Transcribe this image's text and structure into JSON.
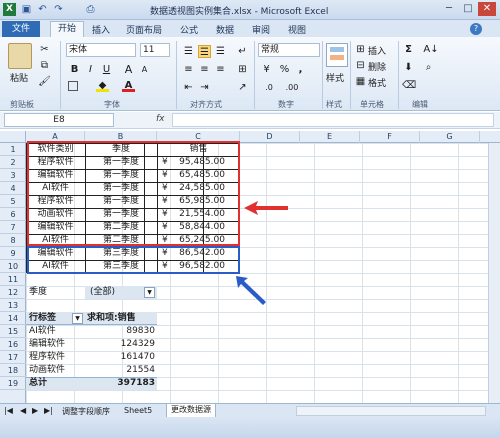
{
  "window": {
    "title": "数据透视图实例集合.xlsx - Microsoft Excel",
    "quick_access": [
      "save-icon",
      "undo-icon",
      "redo-icon",
      "print-icon"
    ],
    "controls": [
      "minimize-icon",
      "maximize-icon",
      "close-icon"
    ]
  },
  "ribbon_tabs": {
    "file": "文件",
    "items": [
      "开始",
      "插入",
      "页面布局",
      "公式",
      "数据",
      "审阅",
      "视图"
    ]
  },
  "ribbon": {
    "clipboard": {
      "label": "剪贴板",
      "paste": "粘贴"
    },
    "font": {
      "label": "字体",
      "name": "宋体",
      "size": "11",
      "bold": "B",
      "italic": "I",
      "underline": "U",
      "grow": "A",
      "shrink": "A"
    },
    "alignment": {
      "label": "对齐方式"
    },
    "number": {
      "label": "数字",
      "format": "常规",
      "percent": "%",
      "comma": ",",
      "increase_decimal": ".0",
      "decrease_decimal": ".00"
    },
    "styles": {
      "label": "样式",
      "button": "样式"
    },
    "cells": {
      "label": "单元格",
      "insert": "插入",
      "delete": "删除",
      "format": "格式"
    },
    "editing": {
      "label": "编辑",
      "sum": "Σ",
      "sort": "A↓"
    }
  },
  "formula_bar": {
    "name_box": "E8",
    "fx": "fx",
    "value": ""
  },
  "grid": {
    "columns": [
      "A",
      "B",
      "C",
      "D",
      "E",
      "F",
      "G"
    ],
    "rows": [
      "1",
      "2",
      "3",
      "4",
      "5",
      "6",
      "7",
      "8",
      "9",
      "10",
      "11",
      "12",
      "13",
      "14",
      "15",
      "16",
      "17",
      "18",
      "19"
    ],
    "table_headers": [
      "软件类别",
      "季度",
      "销售"
    ],
    "table_rows": [
      [
        "程序软件",
        "第一季度",
        "¥    95,485.00"
      ],
      [
        "编辑软件",
        "第一季度",
        "¥    65,485.00"
      ],
      [
        "AI软件",
        "第一季度",
        "¥    24,585.00"
      ],
      [
        "程序软件",
        "第一季度",
        "¥    65,985.00"
      ],
      [
        "动画软件",
        "第一季度",
        "¥    21,554.00"
      ],
      [
        "编辑软件",
        "第二季度",
        "¥    58,844.00"
      ],
      [
        "AI软件",
        "第二季度",
        "¥    65,245.00"
      ],
      [
        "编辑软件",
        "第三季度",
        "¥    86,542.00"
      ],
      [
        "AI软件",
        "第三季度",
        "¥    96,582.00"
      ]
    ],
    "pivot": {
      "filter_label": "季度",
      "filter_value": "(全部)",
      "row_label_header": "行标签",
      "value_header": "求和项:销售",
      "rows": [
        [
          "AI软件",
          "89830"
        ],
        [
          "编辑软件",
          "124329"
        ],
        [
          "程序软件",
          "161470"
        ],
        [
          "动画软件",
          "21554"
        ]
      ],
      "total_label": "总计",
      "total_value": "397183"
    }
  },
  "annotations": {
    "red_box_color": "#e03030",
    "blue_box_color": "#2a5cc8"
  },
  "sheet_tabs": [
    "调整字段顺序",
    "Sheet5",
    "更改数据源"
  ],
  "icons": [
    "filter-dropdown-icon",
    "red-arrow-icon",
    "blue-arrow-icon"
  ]
}
